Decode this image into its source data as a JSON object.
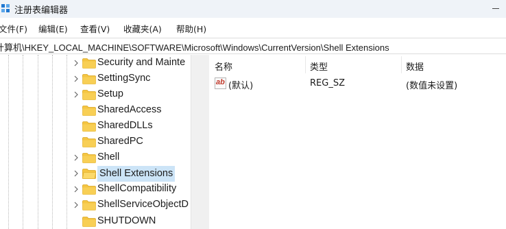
{
  "window": {
    "title": "注册表编辑器",
    "app_icon": "registry-icon",
    "controls": [
      "minimize"
    ]
  },
  "menu": {
    "items": [
      "文件(F)",
      "编辑(E)",
      "查看(V)",
      "收藏夹(A)",
      "帮助(H)"
    ]
  },
  "address": {
    "path": "计算机\\HKEY_LOCAL_MACHINE\\SOFTWARE\\Microsoft\\Windows\\CurrentVersion\\Shell Extensions"
  },
  "tree": {
    "selected": "Shell Extensions",
    "items": [
      {
        "label": "Security and Mainte",
        "expandable": true
      },
      {
        "label": "SettingSync",
        "expandable": true
      },
      {
        "label": "Setup",
        "expandable": true
      },
      {
        "label": "SharedAccess",
        "expandable": false
      },
      {
        "label": "SharedDLLs",
        "expandable": false
      },
      {
        "label": "SharedPC",
        "expandable": false
      },
      {
        "label": "Shell",
        "expandable": true
      },
      {
        "label": "Shell Extensions",
        "expandable": true,
        "selected": true
      },
      {
        "label": "ShellCompatibility",
        "expandable": true
      },
      {
        "label": "ShellServiceObjectD",
        "expandable": true
      },
      {
        "label": "SHUTDOWN",
        "expandable": false
      }
    ]
  },
  "values_pane": {
    "columns": {
      "name": "名称",
      "type": "类型",
      "data": "数据"
    },
    "rows": [
      {
        "icon": "string-value-icon",
        "icon_text": "ab",
        "name": "(默认)",
        "type": "REG_SZ",
        "data": "(数值未设置)"
      }
    ]
  },
  "colors": {
    "selection": "#cce4f7",
    "titlebar": "#eff3f8",
    "folder": "#f5c542",
    "accent": "#1f77d0"
  }
}
